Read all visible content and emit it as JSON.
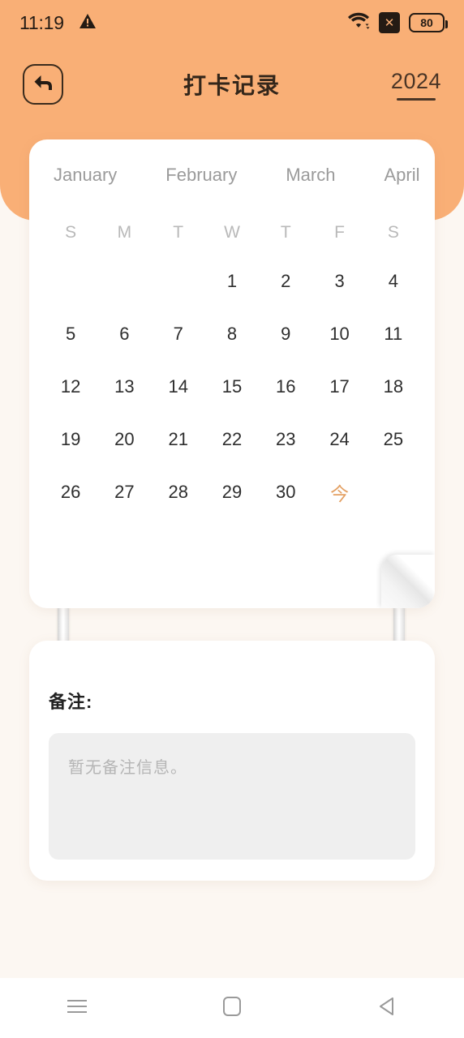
{
  "status_bar": {
    "time": "11:19",
    "warning_icon": "warning-triangle-icon",
    "wifi_icon": "wifi-icon",
    "no_sim_icon": "no-sim-icon",
    "no_sim_glyph": "✕",
    "battery_level": "80"
  },
  "app_bar": {
    "back_icon": "back-arrow-icon",
    "title": "打卡记录",
    "year": "2024"
  },
  "calendar": {
    "months": [
      {
        "label": "January",
        "active": true
      },
      {
        "label": "February",
        "active": false
      },
      {
        "label": "March",
        "active": false
      },
      {
        "label": "April",
        "active": false
      }
    ],
    "weekdays": [
      "S",
      "M",
      "T",
      "W",
      "T",
      "F",
      "S"
    ],
    "today_glyph": "今",
    "weeks": [
      [
        "",
        "",
        "",
        "1",
        "2",
        "3",
        "4"
      ],
      [
        "5",
        "6",
        "7",
        "8",
        "9",
        "10",
        "11"
      ],
      [
        "12",
        "13",
        "14",
        "15",
        "16",
        "17",
        "18"
      ],
      [
        "19",
        "20",
        "21",
        "22",
        "23",
        "24",
        "25"
      ],
      [
        "26",
        "27",
        "28",
        "29",
        "30",
        "今",
        ""
      ]
    ]
  },
  "remarks": {
    "label": "备注:",
    "placeholder": "暂无备注信息。",
    "value": ""
  },
  "nav_bar": {
    "recents_icon": "menu-icon",
    "home_icon": "home-square-icon",
    "back_icon": "back-triangle-icon"
  },
  "colors": {
    "accent_orange": "#F9AF76",
    "page_background": "#FCF7F2",
    "card_white": "#FFFFFF",
    "today_orange": "#E3A063",
    "muted_text": "#9B9B9B",
    "remark_box": "#EFEFEF"
  }
}
